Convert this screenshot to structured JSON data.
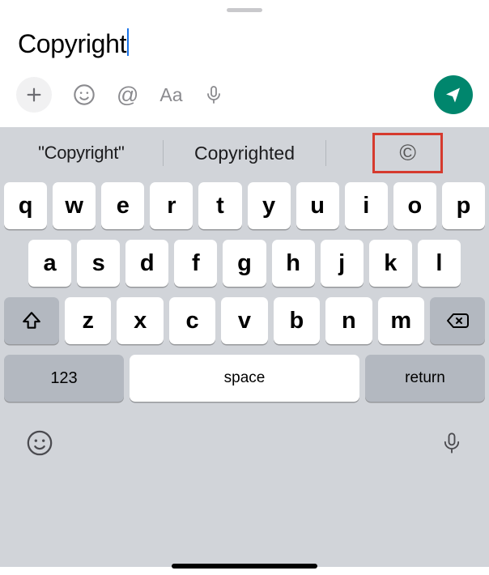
{
  "input": {
    "text": "Copyright"
  },
  "toolbar": {
    "plus": "plus",
    "emoji": "emoji",
    "mention": "@",
    "format": "Aa",
    "voice": "mic",
    "send": "send"
  },
  "suggestions": {
    "s1": "\"Copyright\"",
    "s2": "Copyrighted",
    "s3": "©"
  },
  "keys": {
    "r1": [
      "q",
      "w",
      "e",
      "r",
      "t",
      "y",
      "u",
      "i",
      "o",
      "p"
    ],
    "r2": [
      "a",
      "s",
      "d",
      "f",
      "g",
      "h",
      "j",
      "k",
      "l"
    ],
    "r3": [
      "z",
      "x",
      "c",
      "v",
      "b",
      "n",
      "m"
    ],
    "switch": "123",
    "space": "space",
    "return": "return"
  }
}
